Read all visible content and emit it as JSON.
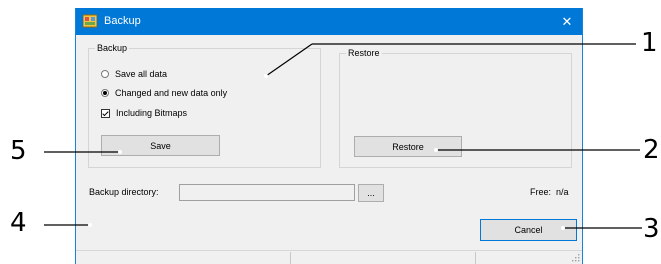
{
  "window": {
    "title": "Backup",
    "close_glyph": "✕",
    "icon": "backup-app-icon"
  },
  "backup_group": {
    "legend": "Backup",
    "options": [
      {
        "label": "Save all data",
        "checked": false
      },
      {
        "label": "Changed and new data only",
        "checked": true
      }
    ],
    "include_bitmaps": {
      "label": "Including Bitmaps",
      "checked": true
    },
    "save_label": "Save"
  },
  "restore_group": {
    "legend": "Restore",
    "restore_label": "Restore"
  },
  "directory": {
    "label": "Backup directory:",
    "value": "",
    "browse_label": "...",
    "free_label": "Free:",
    "free_value": "n/a"
  },
  "cancel_label": "Cancel",
  "callouts": [
    "1",
    "2",
    "3",
    "4",
    "5"
  ],
  "colors": {
    "titlebar": "#0078d7",
    "window_bg": "#f0f0f0",
    "default_button_border": "#0078d7"
  }
}
